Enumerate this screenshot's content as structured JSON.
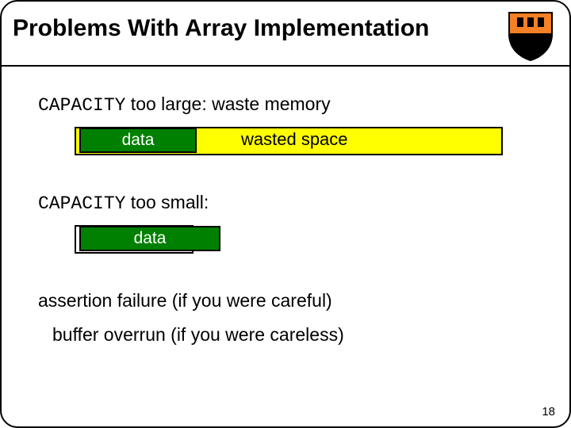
{
  "title": "Problems With Array Implementation",
  "lines": {
    "cap_large_prefix": "CAPACITY",
    "cap_large_rest": " too large: waste memory",
    "data_label": "data",
    "wasted_label": "wasted space",
    "cap_small_prefix": "CAPACITY",
    "cap_small_rest": " too small:",
    "data_label2": "data",
    "assertion": "assertion failure (if you were careful)",
    "overrun": "buffer overrun (if you were careless)"
  },
  "page_number": "18"
}
